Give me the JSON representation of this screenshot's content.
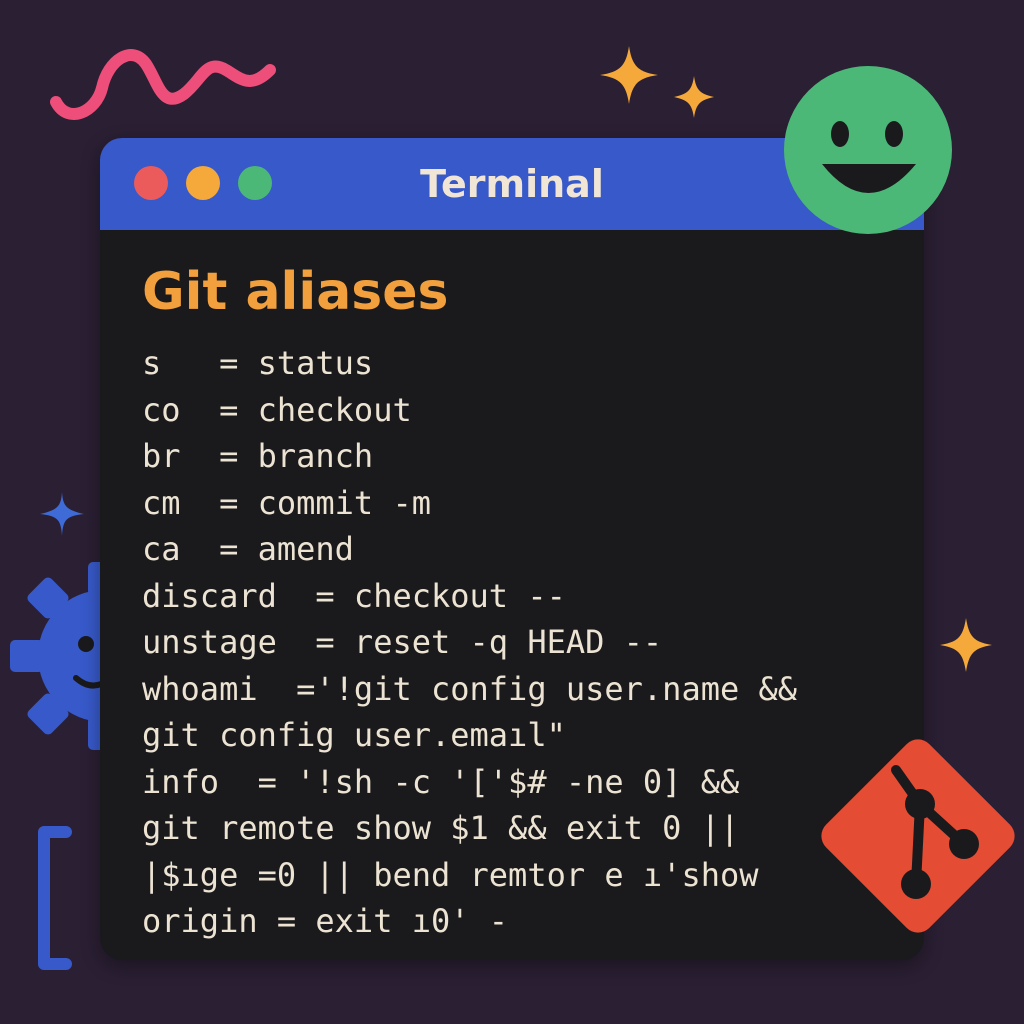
{
  "window": {
    "title": "Terminal"
  },
  "content": {
    "heading": "Git aliases",
    "lines": [
      "s   = status",
      "co  = checkout",
      "br  = branch",
      "cm  = commit -m",
      "ca  = amend",
      "discard  = checkout --",
      "unstage  = reset -q HEAD --",
      "whoami  ='!git config user.name &&",
      "git config user.emaıl\"",
      "info  = '!sh -c '['$# -ne 0] &&",
      "git remote show $1 && exit 0 ||",
      "|$ıge =0 || bend remtor e ı'show",
      "origin = exit ı0' -"
    ]
  },
  "colors": {
    "background": "#2a1f33",
    "titlebar": "#3759c9",
    "terminal_bg": "#1a1a1c",
    "heading": "#f2a03d",
    "text": "#ece3d3",
    "dot_red": "#ec5b5b",
    "dot_yellow": "#f4a93a",
    "dot_green": "#4cb878",
    "smiley": "#4cb878",
    "git_logo": "#e44c34",
    "gear": "#3759c9",
    "squiggle": "#ee4e7a",
    "sparkle": "#f4a93a",
    "plus": "#3759c9"
  },
  "icons": [
    "squiggle-icon",
    "sparkle-icon",
    "smiley-face-icon",
    "plus-icon",
    "gear-face-icon",
    "bracket-icon",
    "git-logo-icon"
  ]
}
